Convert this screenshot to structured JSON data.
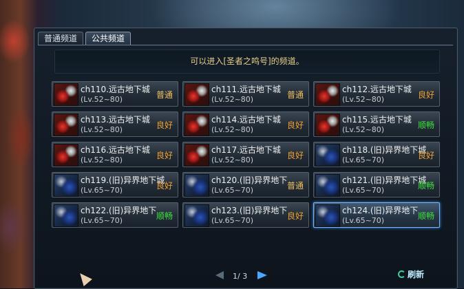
{
  "tabs": [
    {
      "label": "普通频道",
      "active": false
    },
    {
      "label": "公共频道",
      "active": true
    }
  ],
  "notice": "可以进入[圣者之鸣号]的频道。",
  "channels": [
    {
      "name": "ch110.远古地下城",
      "level": "(Lv.52~80)",
      "status": "普通",
      "status_type": "normal",
      "icon": "red-monster-icon",
      "selected": false
    },
    {
      "name": "ch111.远古地下城",
      "level": "(Lv.52~80)",
      "status": "普通",
      "status_type": "normal",
      "icon": "red-monster-icon",
      "selected": false
    },
    {
      "name": "ch112.远古地下城",
      "level": "(Lv.52~80)",
      "status": "良好",
      "status_type": "good",
      "icon": "red-monster-icon",
      "selected": false
    },
    {
      "name": "ch113.远古地下城",
      "level": "(Lv.52~80)",
      "status": "良好",
      "status_type": "good",
      "icon": "red-monster-icon",
      "selected": false
    },
    {
      "name": "ch114.远古地下城",
      "level": "(Lv.52~80)",
      "status": "良好",
      "status_type": "good",
      "icon": "red-monster-icon",
      "selected": false
    },
    {
      "name": "ch115.远古地下城",
      "level": "(Lv.52~80)",
      "status": "顺畅",
      "status_type": "smooth",
      "icon": "red-monster-icon",
      "selected": false
    },
    {
      "name": "ch116.远古地下城",
      "level": "(Lv.52~80)",
      "status": "良好",
      "status_type": "good",
      "icon": "red-monster-icon",
      "selected": false
    },
    {
      "name": "ch117.远古地下城",
      "level": "(Lv.52~80)",
      "status": "良好",
      "status_type": "good",
      "icon": "red-monster-icon",
      "selected": false
    },
    {
      "name": "ch118.(旧)异界地下城",
      "level": "(Lv.65~70)",
      "status": "良好",
      "status_type": "good",
      "icon": "blue-dragon-icon",
      "selected": false
    },
    {
      "name": "ch119.(旧)异界地下城",
      "level": "(Lv.65~70)",
      "status": "良好",
      "status_type": "good",
      "icon": "blue-dragon-icon",
      "selected": false
    },
    {
      "name": "ch120.(旧)异界地下",
      "level": "(Lv.65~70)",
      "status": "普通",
      "status_type": "normal",
      "icon": "blue-dragon-icon",
      "selected": false
    },
    {
      "name": "ch121.(旧)异界地下城",
      "level": "(Lv.65~70)",
      "status": "顺畅",
      "status_type": "smooth",
      "icon": "blue-dragon-icon",
      "selected": false
    },
    {
      "name": "ch122.(旧)异界地下",
      "level": "(Lv.65~70)",
      "status": "顺畅",
      "status_type": "smooth",
      "icon": "blue-dragon-icon",
      "selected": false
    },
    {
      "name": "ch123.(旧)异界地下",
      "level": "(Lv.65~70)",
      "status": "良好",
      "status_type": "good",
      "icon": "blue-dragon-icon",
      "selected": false
    },
    {
      "name": "ch124.(旧)异界地下",
      "level": "(Lv.65~70)",
      "status": "顺畅",
      "status_type": "smooth",
      "icon": "blue-dragon-icon",
      "selected": true
    }
  ],
  "pager": {
    "text": "1/ 3",
    "prev_icon": "left-arrow-icon",
    "next_icon": "right-arrow-icon"
  },
  "refresh": {
    "label": "刷新",
    "icon": "refresh-icon"
  }
}
